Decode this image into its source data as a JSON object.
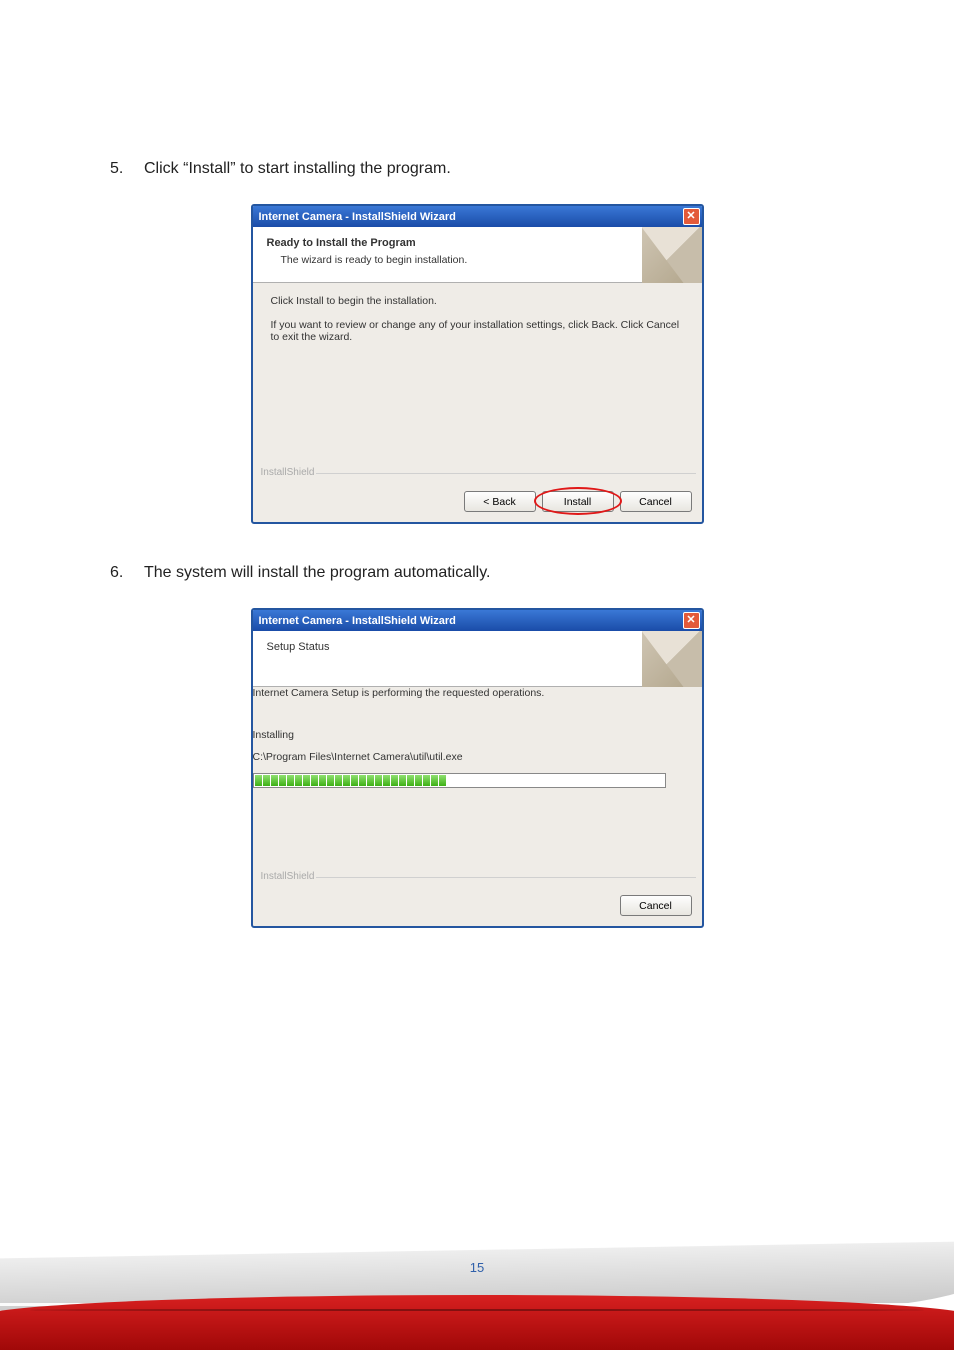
{
  "page_number": "15",
  "steps": {
    "s5": {
      "num": "5.",
      "text": "Click “Install” to start installing the program."
    },
    "s6": {
      "num": "6.",
      "text": "The system will install the program automatically."
    }
  },
  "dialog1": {
    "title": "Internet Camera - InstallShield Wizard",
    "header_bold": "Ready to Install the Program",
    "header_sub": "The wizard is ready to begin installation.",
    "body1": "Click Install to begin the installation.",
    "body2": "If you want to review or change any of your installation settings, click Back. Click Cancel to exit the wizard.",
    "brand": "InstallShield",
    "back": "< Back",
    "install": "Install",
    "cancel": "Cancel"
  },
  "dialog2": {
    "title": "Internet Camera - InstallShield Wizard",
    "header": "Setup Status",
    "body1": "Internet Camera Setup is performing the requested operations.",
    "installing": "Installing",
    "path": "C:\\Program Files\\Internet Camera\\util\\util.exe",
    "brand": "InstallShield",
    "cancel": "Cancel",
    "progress_segments": 24
  }
}
